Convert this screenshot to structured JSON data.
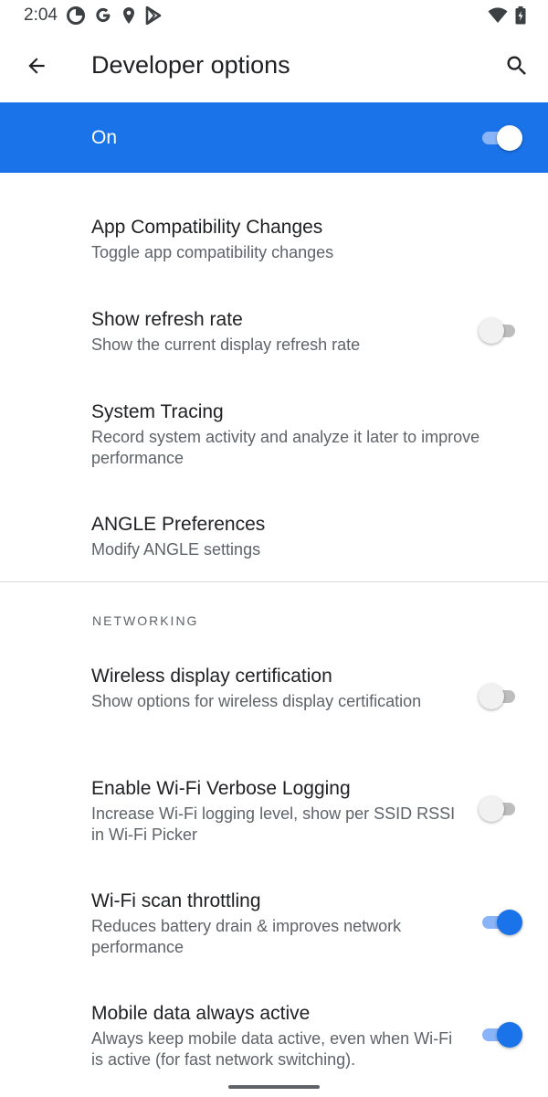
{
  "status_bar": {
    "time": "2:04",
    "icons": [
      "data-saver-icon",
      "google-g-icon",
      "location-icon",
      "play-store-icon"
    ],
    "right_icons": [
      "wifi-icon",
      "battery-icon"
    ]
  },
  "app_bar": {
    "title": "Developer options",
    "back_icon": "arrow-back-icon",
    "search_icon": "search-icon"
  },
  "master_switch": {
    "label": "On",
    "checked": true
  },
  "preferences": [
    {
      "title": "App Compatibility Changes",
      "summary": "Toggle app compatibility changes",
      "has_switch": false
    },
    {
      "title": "Show refresh rate",
      "summary": "Show the current display refresh rate",
      "has_switch": true,
      "checked": false
    },
    {
      "title": "System Tracing",
      "summary": "Record system activity and analyze it later to improve performance",
      "has_switch": false
    },
    {
      "title": "ANGLE Preferences",
      "summary": "Modify ANGLE settings",
      "has_switch": false
    }
  ],
  "networking": {
    "header": "NETWORKING",
    "items": [
      {
        "title": "Wireless display certification",
        "summary": "Show options for wireless display certification",
        "has_switch": true,
        "checked": false
      },
      {
        "title": "Enable Wi-Fi Verbose Logging",
        "summary": "Increase Wi-Fi logging level, show per SSID RSSI in Wi-Fi Picker",
        "has_switch": true,
        "checked": false
      },
      {
        "title": "Wi-Fi scan throttling",
        "summary": "Reduces battery drain & improves network performance",
        "has_switch": true,
        "checked": true
      },
      {
        "title": "Mobile data always active",
        "summary": "Always keep mobile data active, even when Wi-Fi is active (for fast network switching).",
        "has_switch": true,
        "checked": true
      }
    ]
  },
  "colors": {
    "accent": "#1a73e8",
    "accent_light": "#8ab4f8",
    "text_primary": "#202124",
    "text_secondary": "#5f6368"
  }
}
